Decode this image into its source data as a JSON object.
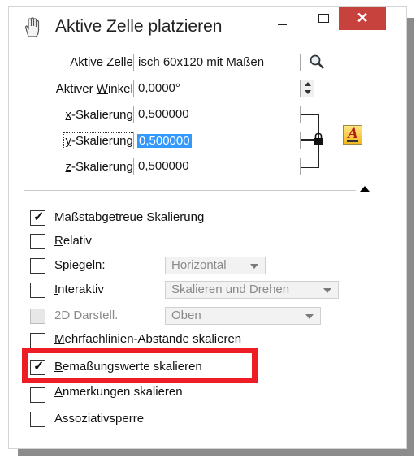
{
  "window": {
    "title": "Aktive Zelle platzieren",
    "close_glyph": "✕",
    "accent_close": "#c7423d"
  },
  "fields": {
    "active_cell": {
      "label_pre": "A",
      "label_u": "k",
      "label_post": "tive Zelle:",
      "value": "isch 60x120 mit Maßen"
    },
    "active_angle": {
      "label_pre": "Aktiver ",
      "label_u": "W",
      "label_post": "inkel:",
      "value": "0,0000°"
    },
    "x_scale": {
      "label_u": "x",
      "label_post": "-Skalierung:",
      "value": "0,500000"
    },
    "y_scale": {
      "label_u": "y",
      "label_post": "-Skalierung:",
      "value": "0,500000"
    },
    "z_scale": {
      "label_u": "z",
      "label_post": "-Skalierung:",
      "value": "0,500000"
    }
  },
  "checkboxes": [
    {
      "pre": "Ma",
      "u": "ß",
      "post": "stabgetreue Skalierung",
      "checked": true
    },
    {
      "pre": "",
      "u": "R",
      "post": "elativ",
      "checked": false
    },
    {
      "pre": "",
      "u": "S",
      "post": "piegeln:",
      "checked": false
    },
    {
      "pre": "",
      "u": "I",
      "post": "nteraktiv",
      "checked": false
    },
    {
      "pre": "2D Darstell.",
      "u": "",
      "post": "",
      "checked": false,
      "disabled": true
    },
    {
      "pre": "",
      "u": "M",
      "post": "ehrfachlinien-Abstände skalieren",
      "checked": false
    },
    {
      "pre": "",
      "u": "B",
      "post": "emaßungswerte skalieren",
      "checked": true
    },
    {
      "pre": "",
      "u": "A",
      "post": "nmerkungen skalieren",
      "checked": false
    },
    {
      "pre": "Assoziativsperre",
      "u": "",
      "post": "",
      "checked": false
    }
  ],
  "dropdowns": {
    "mirror": "Horizontal",
    "interactive": "Skalieren und Drehen",
    "view": "Oben"
  },
  "highlight_color": "#ee1c25"
}
